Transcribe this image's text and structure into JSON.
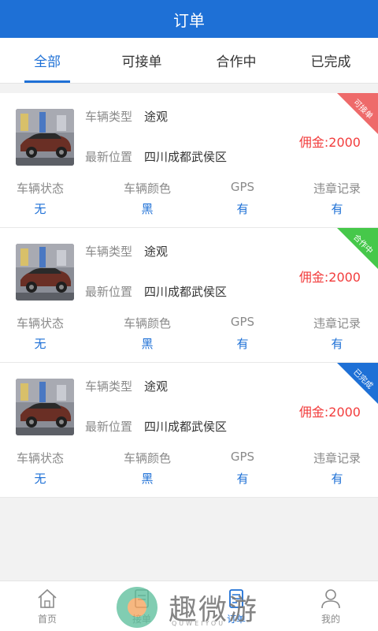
{
  "header": {
    "title": "订单"
  },
  "tabs": [
    {
      "label": "全部",
      "active": true
    },
    {
      "label": "可接单",
      "active": false
    },
    {
      "label": "合作中",
      "active": false
    },
    {
      "label": "已完成",
      "active": false
    }
  ],
  "orders": [
    {
      "badge": "可接单",
      "badge_color": "#ee6a6a",
      "type_label": "车辆类型",
      "type_value": "途观",
      "loc_label": "最新位置",
      "loc_value": "四川成都武侯区",
      "deposit": "佣金:2000",
      "stats": [
        {
          "label": "车辆状态",
          "value": "无"
        },
        {
          "label": "车辆颜色",
          "value": "黑"
        },
        {
          "label": "GPS",
          "value": "有"
        },
        {
          "label": "违章记录",
          "value": "有"
        }
      ]
    },
    {
      "badge": "合作中",
      "badge_color": "#46c84a",
      "type_label": "车辆类型",
      "type_value": "途观",
      "loc_label": "最新位置",
      "loc_value": "四川成都武侯区",
      "deposit": "佣金:2000",
      "stats": [
        {
          "label": "车辆状态",
          "value": "无"
        },
        {
          "label": "车辆颜色",
          "value": "黑"
        },
        {
          "label": "GPS",
          "value": "有"
        },
        {
          "label": "违章记录",
          "value": "有"
        }
      ]
    },
    {
      "badge": "已完成",
      "badge_color": "#1e70d6",
      "type_label": "车辆类型",
      "type_value": "途观",
      "loc_label": "最新位置",
      "loc_value": "四川成都武侯区",
      "deposit": "佣金:2000",
      "stats": [
        {
          "label": "车辆状态",
          "value": "无"
        },
        {
          "label": "车辆颜色",
          "value": "黑"
        },
        {
          "label": "GPS",
          "value": "有"
        },
        {
          "label": "违章记录",
          "value": "有"
        }
      ]
    }
  ],
  "nav": [
    {
      "label": "首页",
      "icon": "home-icon",
      "active": false
    },
    {
      "label": "接单",
      "icon": "order-accept-icon",
      "active": false
    },
    {
      "label": "订单",
      "icon": "order-list-icon",
      "active": true
    },
    {
      "label": "我的",
      "icon": "profile-icon",
      "active": false
    }
  ],
  "watermark": {
    "text": "趣微游",
    "sub": "QUWEIYOU"
  },
  "colors": {
    "primary": "#1e70d6",
    "danger": "#f23c3c"
  }
}
